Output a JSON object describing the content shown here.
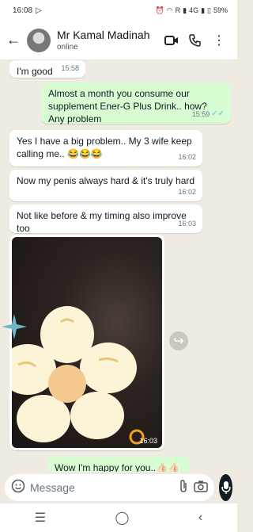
{
  "status_bar": {
    "time": "16:08",
    "network": "R",
    "network_type": "4G",
    "battery": "59%"
  },
  "header": {
    "contact_name": "Mr Kamal Madinah",
    "status": "online"
  },
  "messages": [
    {
      "dir": "in",
      "text": "I'm good",
      "time": "15:58"
    },
    {
      "dir": "out",
      "text": "Almost a month you consume our supplement Ener-G Plus Drink.. how? Any problem",
      "time": "15:59"
    },
    {
      "dir": "in",
      "text": "Yes I have a big problem.. My 3 wife keep calling me.. 😂😂😂",
      "time": "16:02"
    },
    {
      "dir": "in",
      "text": "Now my penis always hard & it's truly hard",
      "time": "16:02"
    },
    {
      "dir": "in",
      "text": "Not like before & my timing also improve too",
      "time": "16:03"
    },
    {
      "dir": "in",
      "type": "image",
      "time": "16:03"
    },
    {
      "dir": "out",
      "text": "Wow I'm happy for you..👍🏻👍🏻",
      "time": ""
    }
  ],
  "input": {
    "placeholder": "Message"
  },
  "colors": {
    "outgoing_bubble": "#d9fdd3",
    "incoming_bubble": "#ffffff",
    "chat_background": "#efeae2",
    "read_ticks": "#53bdeb"
  }
}
